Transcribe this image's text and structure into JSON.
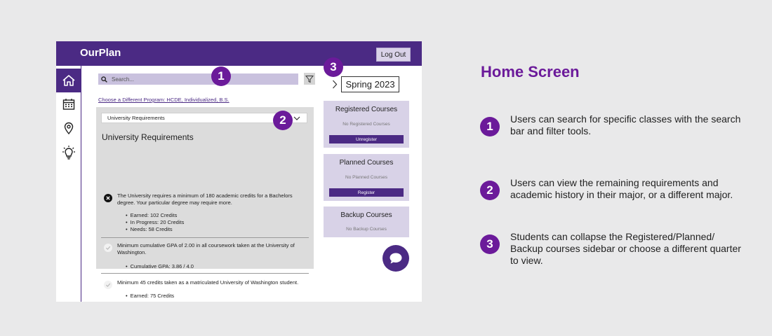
{
  "app": {
    "brand": "OurPlan",
    "logout_label": "Log Out",
    "nav": [
      {
        "name": "home",
        "icon": "home-icon",
        "active": true
      },
      {
        "name": "calendar",
        "icon": "calendar-icon",
        "active": false
      },
      {
        "name": "location",
        "icon": "location-pin-icon",
        "active": false
      },
      {
        "name": "ideas",
        "icon": "lightbulb-icon",
        "active": false
      }
    ],
    "search": {
      "placeholder": "Search...",
      "icon": "search-icon"
    },
    "filter_icon": "filter-icon",
    "program_link": "Choose a Different Program: HCDE, Individualized, B.S.",
    "requirements": {
      "selected": "University Requirements",
      "title": "University Requirements",
      "items": [
        {
          "status": "incomplete",
          "text": "The University requires a minimum of 180 academic credits for a Bachelors degree. Your particular degree may require more.",
          "details": [
            "Earned: 102 Credits",
            "In Progress: 20 Credits",
            "Needs: 58 Credits"
          ]
        },
        {
          "status": "complete",
          "text": "Minimum cumulative GPA of 2.00 in all coursework taken at the University of Washington.",
          "details": [
            "Cumulative GPA: 3.86 / 4.0"
          ]
        },
        {
          "status": "complete",
          "text": "Minimum 45 credits taken as a matriculated University of Washington student.",
          "details": [
            "Earned: 75 Credits"
          ]
        }
      ]
    },
    "quarter": "Spring 2023",
    "courses": {
      "registered": {
        "title": "Registered Courses",
        "empty": "No Registered Courses",
        "button": "Unregister"
      },
      "planned": {
        "title": "Planned Courses",
        "empty": "No Planned Courses",
        "button": "Register"
      },
      "backup": {
        "title": "Backup Courses",
        "empty": "No Backup Courses"
      }
    },
    "markers": [
      "1",
      "2",
      "3"
    ]
  },
  "explanation": {
    "heading": "Home Screen",
    "notes": [
      {
        "number": "1",
        "text": "Users can search for specific classes with the search bar and filter tools."
      },
      {
        "number": "2",
        "text": "Users can view the remaining requirements and academic history in their major, or a different major."
      },
      {
        "number": "3",
        "text": "Students can collapse the Registered/Planned/ Backup courses sidebar or choose a different quarter to view."
      }
    ]
  },
  "colors": {
    "brand_purple": "#4b2a84",
    "marker_purple": "#6b1a9a",
    "card_lavender": "#d8d2e7",
    "panel_gray": "#dcdcdc",
    "page_background": "#e9e9ea"
  }
}
